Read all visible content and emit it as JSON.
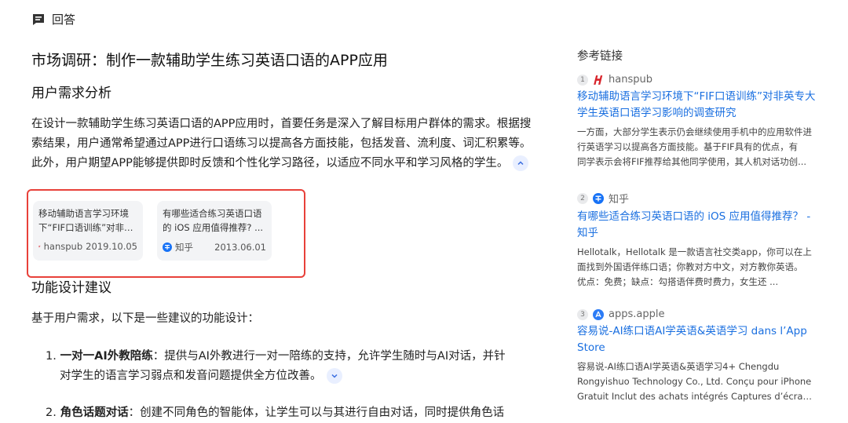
{
  "header": {
    "label": "回答",
    "icon": "chat-bubble-icon"
  },
  "main": {
    "title": "市场调研：制作一款辅助学生练习英语口语的APP应用",
    "section1_title": "用户需求分析",
    "paragraph": "在设计一款辅助学生练习英语口语的APP应用时，首要任务是深入了解目标用户群体的需求。根据搜索结果，用户通常希望通过APP进行口语练习以提高各方面技能，包括发音、流利度、词汇积累等。此外，用户期望APP能够提供即时反馈和个性化学习路径，以适应不同水平和学习风格的学生。",
    "cards": [
      {
        "title_line1": "移动辅助语言学习环境",
        "title_line2": "下“FIF口语训练”对非英...",
        "source": "hanspub",
        "date": "2019.10.05"
      },
      {
        "title_line1": "有哪些适合练习英语口语",
        "title_line2": "的 iOS 应用值得推荐? ...",
        "source": "知乎",
        "date": "2013.06.01"
      }
    ],
    "section2_title": "功能设计建议",
    "intro": "基于用户需求，以下是一些建议的功能设计：",
    "list": [
      {
        "num": "1.",
        "bold": "一对一AI外教陪练",
        "text_line1": "：提供与AI外教进行一对一陪练的支持，允许学生随时与AI对话，并针",
        "text_line2": "对学生的语言学习弱点和发音问题提供全方位改善。"
      },
      {
        "num": "2.",
        "bold": "角色话题对话",
        "text_line1": "：创建不同角色的智能体，让学生可以与其进行自由对话，同时提供角色话"
      }
    ]
  },
  "sidebar": {
    "heading": "参考链接",
    "refs": [
      {
        "num": "1",
        "source": "hanspub",
        "title": "移动辅助语言学习环境下“FIF口语训练”对非英专大学生英语口语学习影响的调查研究",
        "snippet": "一方面，大部分学生表示仍会继续使用手机中的应用软件进行英语学习以提高各方面技能。基于FIF具有的优点，有",
        "snippet_last": "同学表示会将FIF推荐给其他同学使用，其人机对话功创..."
      },
      {
        "num": "2",
        "source": "知乎",
        "title": "有哪些适合练习英语口语的 iOS 应用值得推荐？ - 知乎",
        "snippet": "Hellotalk，Hellotalk 是一款语言社交类app，你可以在上面找到外国语伴练口语；你教对方中文，对方教你英语。",
        "snippet_last": "优点：免费；缺点：勾搭语伴费时费力，女生还 ..."
      },
      {
        "num": "3",
        "source": "apps.apple",
        "title": "容易说-AI练口语AI学英语&英语学习 dans l’App Store",
        "snippet": "容易说-AI练口语AI学英语&英语学习4+ Chengdu Rongyishuo Technology Co., Ltd. Conçu pour iPhone",
        "snippet_last": "Gratuit Inclut des achats intégrés Captures d’écran..."
      }
    ]
  },
  "colors": {
    "link": "#1a6fe0",
    "highlight_frame": "#e8413a",
    "hanspub": "#d8232a",
    "zhihu": "#1772f6",
    "apple": "#2c7cf6"
  }
}
